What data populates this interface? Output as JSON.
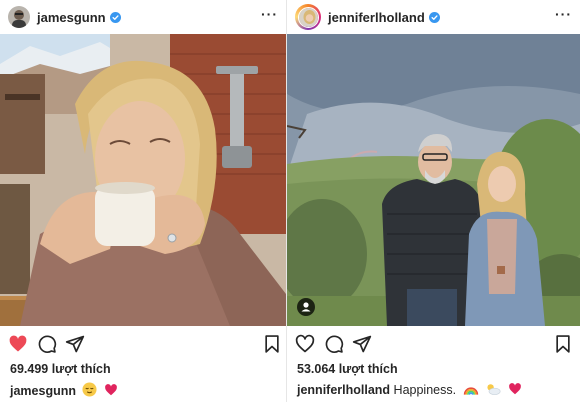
{
  "posts": [
    {
      "username": "jamesgunn",
      "more_label": "···",
      "likes": "69.499 lượt thích",
      "caption_user": "jamesgunn",
      "caption_text": "",
      "liked": true
    },
    {
      "username": "jenniferlholland",
      "more_label": "···",
      "likes": "53.064 lượt thích",
      "caption_user": "jenniferlholland",
      "caption_text": "Happiness.",
      "liked": false
    }
  ],
  "icons": {
    "like": "heart-icon",
    "comment": "comment-icon",
    "share": "share-icon",
    "save": "bookmark-icon",
    "verified": "verified-badge-icon",
    "more": "more-options-icon",
    "tag": "user-tag-icon"
  },
  "colors": {
    "like_active": "#ed4956",
    "verified": "#3897f0",
    "text": "#262626"
  }
}
